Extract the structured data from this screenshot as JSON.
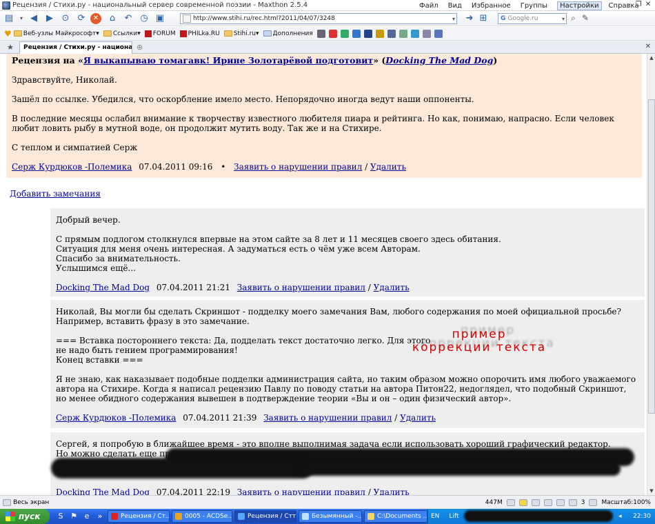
{
  "window": {
    "title": "Рецензия / Стихи.ру - национальный сервер современной поэзии - Maxthon 2.5.4",
    "menus": [
      "Файл",
      "Вид",
      "Избранное",
      "Группы",
      "Настройки",
      "Справка"
    ]
  },
  "toolbar": {
    "url": "http://www.stihi.ru/rec.html?2011/04/07/3248",
    "search_placeholder": "Google.ru"
  },
  "favorites": [
    "Веб-узлы Майкрософт",
    "Ссылки",
    "FORUM",
    "PHILka.RU",
    "Stihi.ru",
    "Дополнения"
  ],
  "tab": {
    "label": "Рецензия / Стихи.ру - национа..."
  },
  "review": {
    "prefix": "Рецензия на «",
    "work_title": "Я выкапываю томагавк! Ирине Золотарёвой подготовит",
    "mid": "» (",
    "work_author": "Docking The Mad Dog",
    "suffix": ")",
    "greeting": "Здравствуйте, Николай.",
    "p1": "Зашёл по ссылке. Убедился, что оскорбление имело место. Непорядочно иногда ведут наши оппоненты.",
    "p2": "В последние месяцы ослабил внимание к творчеству известного любителя пиара и рейтинга. Но как, понимаю, напрасно. Если человек любит ловить рыбу в мутной воде, он продолжит мутить воду. Так же и на Стихире.",
    "closing": "С теплом и симпатией Серж",
    "author": "Серж Курдюков -Полемика",
    "date": "07.04.2011 09:16",
    "bullet": "•",
    "report": "Заявить о нарушении правил",
    "slash": "/",
    "delete": "Удалить"
  },
  "add_note": "Добавить замечания",
  "comments": [
    {
      "lines": [
        "Добрый вечер."
      ],
      "lines2": [
        "С прямым подлогом столкнулся впервые на этом сайте за 8 лет и 11 месяцев своего здесь обитания.",
        "Ситуация для меня очень интересная. А задуматься есть о чём уже всем Авторам.",
        "Спасибо за внимательность.",
        "Услышимся ещё..."
      ],
      "author": "Docking The Mad Dog",
      "date": "07.04.2011 21:21",
      "report": "Заявить о нарушении правил",
      "delete": "Удалить"
    },
    {
      "l1": "Николай, Вы могли бы сделать Скриншот - подделку моего замечания Вам, любого содержания по моей официальной просьбе? Например, вставить фразу в это замечание.",
      "l2": "=== Вставка постороннего текста: Да, подделать текст достаточно легко. Для этого",
      "l3": "не надо быть гением программирования!",
      "l4": "Конец вставки ===",
      "l5": "Я не знаю, как наказывает подобные подделки администрация сайта, но таким образом можно опорочить имя любого уважаемого автора на Стихире. Когда я написал рецензию Павлу по поводу статьи на автора Питон22, недоглядел, что подобный Скриншот, но менее обидного содержания вывешен в подтверждение теории «Вы и он – один физический автор».",
      "overlay_1": "пример",
      "overlay_2": "коррекции текста",
      "ghost_1": "пример",
      "ghost_2": "коррекции текста",
      "author": "Серж Курдюков -Полемика",
      "date": "07.04.2011 21:39",
      "report": "Заявить о нарушении правил",
      "delete": "Удалить"
    },
    {
      "l1": "Сергей, я попробую в ближайшее время - это вполне выполнимая задача если использовать хороший графический редактор.",
      "l2": "Но можно сделать еще проще",
      "author": "Docking The Mad Dog",
      "date": "07.04.2011 22:19",
      "report": "Заявить о нарушении правил",
      "delete": "Удалить"
    }
  ],
  "status": {
    "fullscreen": "Весь экран",
    "memory": "447M",
    "count": "3",
    "zoom": "Масштаб:100%"
  },
  "taskbar": {
    "start": "пуск",
    "tasks": [
      "Рецензия / Ст...",
      "0005 - ACDSe...",
      "Рецензия / Стт...",
      "Безымянный -...",
      "C:\\Documents ..."
    ],
    "lang": "EN",
    "lift": "Lift",
    "clock": "22:30"
  }
}
